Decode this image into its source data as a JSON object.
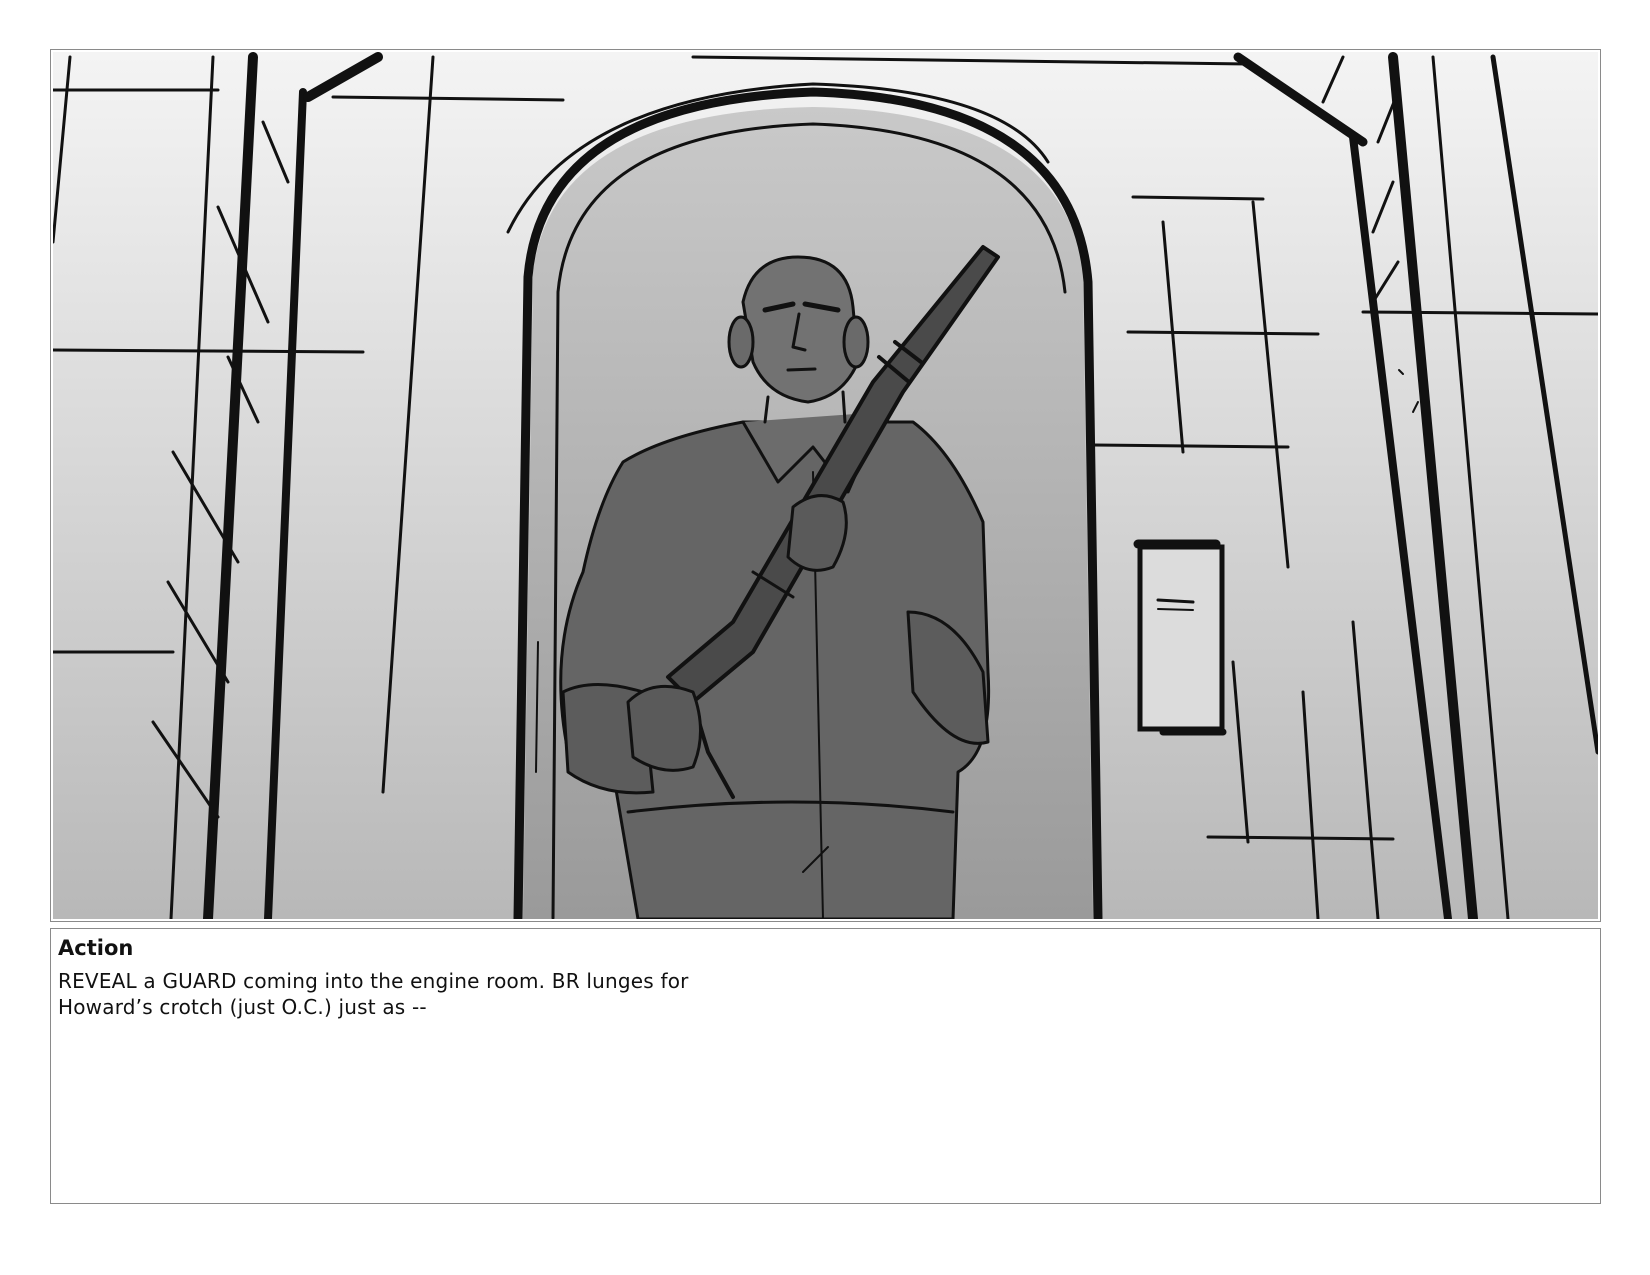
{
  "storyboard_panel": {
    "image_description_name": "guard-with-rifle-in-doorway-sketch"
  },
  "notes": {
    "heading": "Action",
    "line1": "REVEAL a GUARD coming into the engine room. BR lunges for",
    "line2": "Howard’s crotch (just O.C.) just as --"
  }
}
